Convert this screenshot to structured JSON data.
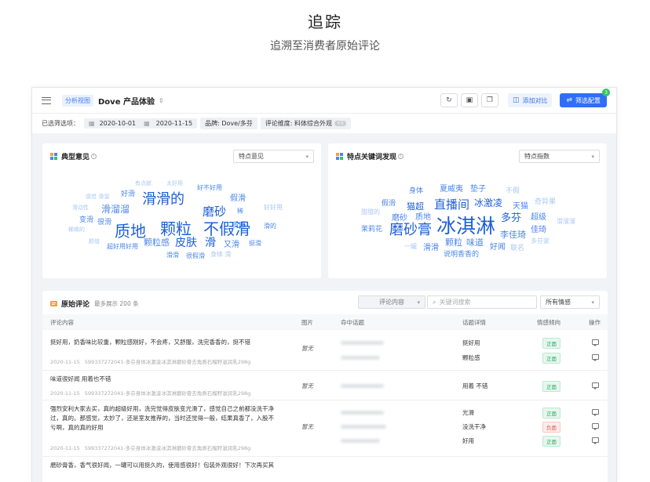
{
  "hero": {
    "title": "追踪",
    "subtitle": "追溯至消费者原始评论"
  },
  "topbar": {
    "view_tag": "分析视图",
    "product": "Dove 产品体验",
    "compare": "添加对比",
    "filter": "筛选配置",
    "filter_badge": "3"
  },
  "filterbar": {
    "label": "已选筛选项：",
    "date_start": "2020-10-01",
    "date_end": "2020-11-15",
    "brand": "品牌: Dove/多芬",
    "dimension": "评论维度: 料体综合外观",
    "dimension_count": "+5"
  },
  "panel_opinions": {
    "title": "典型意见",
    "select": "特点意见"
  },
  "panel_keywords": {
    "title": "特点关键词发现",
    "select": "特点指数"
  },
  "cloud1": [
    "有点腻",
    "太好用",
    "好不好用",
    "好滑",
    "滑滑的",
    "假滑",
    "滑溜溜",
    "磨砂",
    "稀",
    "质感",
    "好好用",
    "变滑",
    "很滑",
    "质地",
    "颗粒",
    "不假滑",
    "滑的",
    "颗粒感",
    "皮肤",
    "滑",
    "又滑",
    "挺滑",
    "超好用好用",
    "滑滑",
    "很假滑",
    "身体 滑",
    "感觉 滑溜",
    "滑动性",
    "稀稀的",
    "颜值"
  ],
  "cloud2": [
    "身体",
    "夏威夷",
    "垫子",
    "不假",
    "假滑",
    "猫超",
    "直播间",
    "冰激凌",
    "天猫",
    "奇异果",
    "甜甜的",
    "磨砂",
    "质地",
    "多芬",
    "超级",
    "茉莉花",
    "磨砂膏",
    "冰淇淋",
    "佳琦",
    "滑溜溜",
    "李佳琦",
    "颗粒",
    "味道",
    "好闻",
    "一罐",
    "滑滑",
    "说明香香的",
    "联名",
    "多芬家"
  ],
  "reviews": {
    "title": "原始评论",
    "subtitle": "最多展示 200 条",
    "topic_select": "评论内容",
    "search_placeholder": "关键词搜索",
    "sentiment_select": "所有情感",
    "headers": [
      "评论内容",
      "图片",
      "命中话题",
      "话题详情",
      "情感倾向",
      "操作"
    ],
    "rows": [
      {
        "text": "挺好用，奶香味比较重，颗粒感刚好，不会疼，又舒服，洗完香香的，挺不错",
        "date": "2020-11-15",
        "sku": "599337272041-多芬身体冰激凌冰淇淋磨砂膏去角质石榴籽滋润乳298g",
        "img": "暂无",
        "topics": [
          "挺好用",
          "颗粒感"
        ],
        "sents": [
          "正面",
          "正面"
        ]
      },
      {
        "text": "味道很好闻 用着也不错",
        "date": "2020-11-15",
        "sku": "599337272041-多芬身体冰激凌冰淇淋磨砂膏去角质石榴籽滋润乳298g",
        "img": "暂无",
        "topics": [
          "用着 不错"
        ],
        "sents": [
          "正面"
        ]
      },
      {
        "text": "强烈安利大家去买，真的超级好用，洗完觉得皮肤变光滑了，感觉自己之前都没洗干净过，真的。那感觉，太妙了，还是室友推荐的，当时还觉得一般，结果真香了，入股不亏啊，真的真的好用",
        "date": "2020-11-15",
        "sku": "599337272041-多芬身体冰激凌冰淇淋磨砂膏去角质石榴籽滋润乳298g",
        "img": "暂无",
        "topics": [
          "光滑",
          "没洗干净",
          "好用"
        ],
        "sents": [
          "正面",
          "负面",
          "正面"
        ]
      },
      {
        "text": "磨砂膏香，香气很好闻，一罐可以用挺久的，使用感很好！包装外观很好！下次再买其"
      }
    ]
  },
  "colors": {
    "accent": "#2f6ef6",
    "cloud_dark": "#1f5fd9",
    "cloud_mid": "#4a86e8",
    "cloud_light": "#a9c8f3"
  }
}
